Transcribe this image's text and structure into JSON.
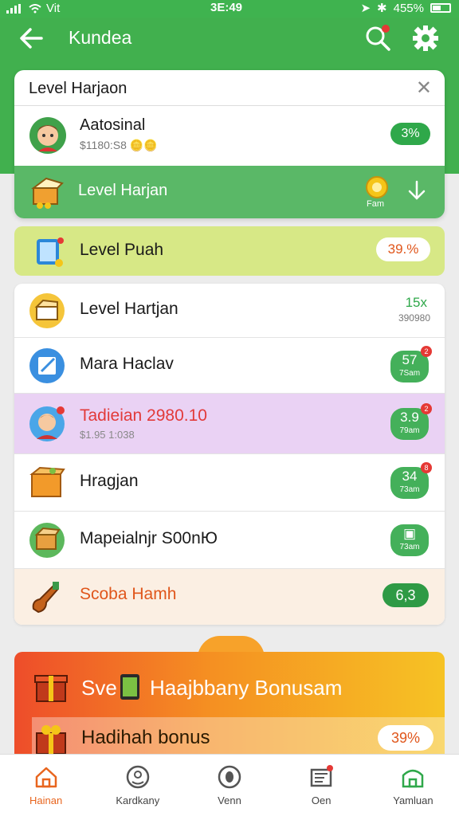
{
  "status": {
    "carrier": "Vit",
    "time": "3E:49",
    "battery": "455%"
  },
  "header": {
    "title": "Kundea",
    "search_badge": "2"
  },
  "popup": {
    "title": "Level Harjaon",
    "item": {
      "name": "Aatosinal",
      "sub": "$1180:S8",
      "pill": "3%"
    },
    "green_row": {
      "label": "Level Harjan",
      "coin_label": "Fam"
    }
  },
  "banner": {
    "label": "Level Puah",
    "pill": "39.%"
  },
  "list": [
    {
      "label": "Level Hartjan",
      "val": "15x",
      "sub": "390980"
    },
    {
      "label": "Mara Haclav",
      "val": "57",
      "sub": "7Sam",
      "dot": "2"
    },
    {
      "label": "Tadieian 2980.10",
      "sub": "$1.95 1:038",
      "val": "3.9",
      "valsub": "79am",
      "dot": "2"
    },
    {
      "label": "Hragjan",
      "val": "34",
      "sub": "73am",
      "dot": "8"
    },
    {
      "label": "Mapeialnjr S00nЮ",
      "val": "",
      "sub": "73am"
    },
    {
      "label": "Scoba Hamh",
      "val": "6,3"
    }
  ],
  "bonus": {
    "title_a": "Sve",
    "title_b": "Haajbbany Bonusam",
    "row2": "Hadihah bonus",
    "pill": "39%"
  },
  "nav": [
    {
      "label": "Hainan"
    },
    {
      "label": "Kardkany"
    },
    {
      "label": "Venn"
    },
    {
      "label": "Oen"
    },
    {
      "label": "Yamluan"
    }
  ],
  "colors": {
    "brand_green": "#41b04e",
    "accent_orange": "#e8651e",
    "highlight_purple": "#ead2f4",
    "banner_yellow": "#d7e886"
  }
}
